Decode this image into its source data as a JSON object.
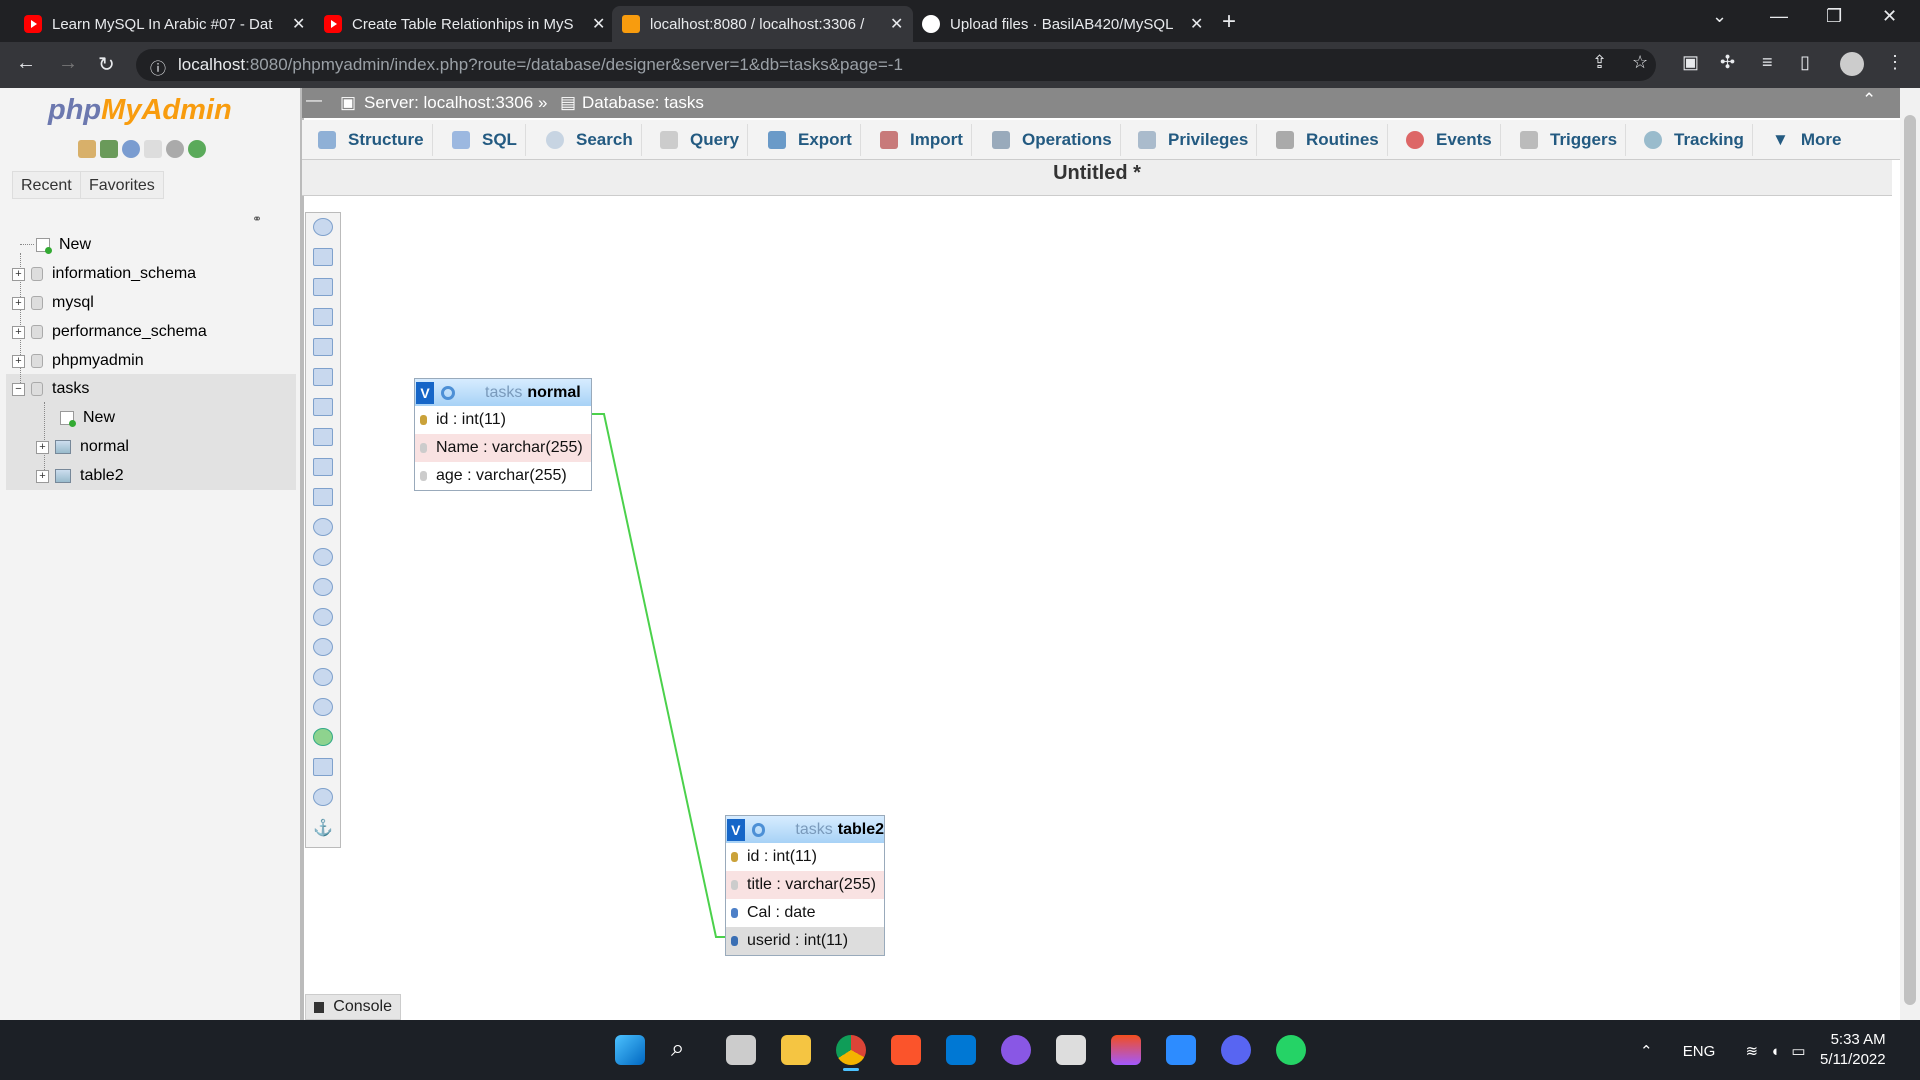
{
  "browser": {
    "tabs": [
      {
        "title": "Learn MySQL In Arabic #07 - Dat",
        "favicon": "youtube-icon"
      },
      {
        "title": "Create Table Relationhips in MyS",
        "favicon": "youtube-icon"
      },
      {
        "title": "localhost:8080 / localhost:3306 /",
        "favicon": "phpmyadmin-icon"
      },
      {
        "title": "Upload files · BasilAB420/MySQL",
        "favicon": "github-icon"
      }
    ],
    "url_host": "localhost",
    "url_rest": ":8080/phpmyadmin/index.php?route=/database/designer&server=1&db=tasks&page=-1"
  },
  "pma": {
    "logo_php": "php",
    "logo_myadmin": "MyAdmin",
    "recent_label": "Recent",
    "favorites_label": "Favorites",
    "tree": [
      {
        "label": "New"
      },
      {
        "label": "information_schema"
      },
      {
        "label": "mysql"
      },
      {
        "label": "performance_schema"
      },
      {
        "label": "phpmyadmin"
      },
      {
        "label": "tasks"
      },
      {
        "label": "New"
      },
      {
        "label": "normal"
      },
      {
        "label": "table2"
      }
    ],
    "breadcrumb": {
      "server": "Server: localhost:3306",
      "sep": "»",
      "database": "Database: tasks"
    },
    "menu": [
      "Structure",
      "SQL",
      "Search",
      "Query",
      "Export",
      "Import",
      "Operations",
      "Privileges",
      "Routines",
      "Events",
      "Triggers",
      "Tracking",
      "More"
    ],
    "page_title": "Untitled *",
    "console_label": "Console"
  },
  "designer": {
    "tables": [
      {
        "db": "tasks",
        "name": "normal",
        "toggle": "V",
        "columns": [
          {
            "label": "id : int(11)"
          },
          {
            "label": "Name : varchar(255)"
          },
          {
            "label": "age : varchar(255)"
          }
        ]
      },
      {
        "db": "tasks",
        "name": "table2",
        "toggle": "V",
        "columns": [
          {
            "label": "id : int(11)"
          },
          {
            "label": "title : varchar(255)"
          },
          {
            "label": "Cal : date"
          },
          {
            "label": "userid : int(11)"
          }
        ]
      }
    ],
    "relation_color": "#4bd14b"
  },
  "taskbar": {
    "lang": "ENG",
    "time": "5:33 AM",
    "date": "5/11/2022"
  }
}
